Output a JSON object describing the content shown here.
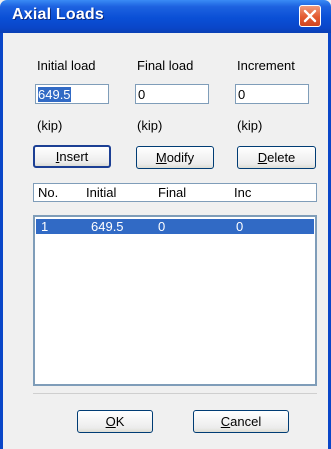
{
  "window": {
    "title": "Axial Loads"
  },
  "labels": {
    "initial": "Initial load",
    "final": "Final load",
    "increment": "Increment",
    "unit": "(kip)"
  },
  "inputs": {
    "initial": "649.5",
    "final": "0",
    "increment": "0"
  },
  "buttons": {
    "insert": {
      "pre": "",
      "ul": "I",
      "post": "nsert"
    },
    "modify": {
      "pre": "",
      "ul": "M",
      "post": "odify"
    },
    "delete": {
      "pre": "",
      "ul": "D",
      "post": "elete"
    },
    "ok": {
      "pre": "",
      "ul": "O",
      "post": "K"
    },
    "cancel": {
      "pre": "",
      "ul": "C",
      "post": "ancel"
    }
  },
  "table": {
    "columns": [
      "No.",
      "Initial",
      "Final",
      "Inc"
    ],
    "rows": [
      {
        "no": "1",
        "initial": "649.5",
        "final": "0",
        "inc": "0"
      }
    ]
  },
  "colors": {
    "title_bar": "#0a46c8",
    "selection": "#316ac5",
    "close_button": "#e35a30"
  }
}
